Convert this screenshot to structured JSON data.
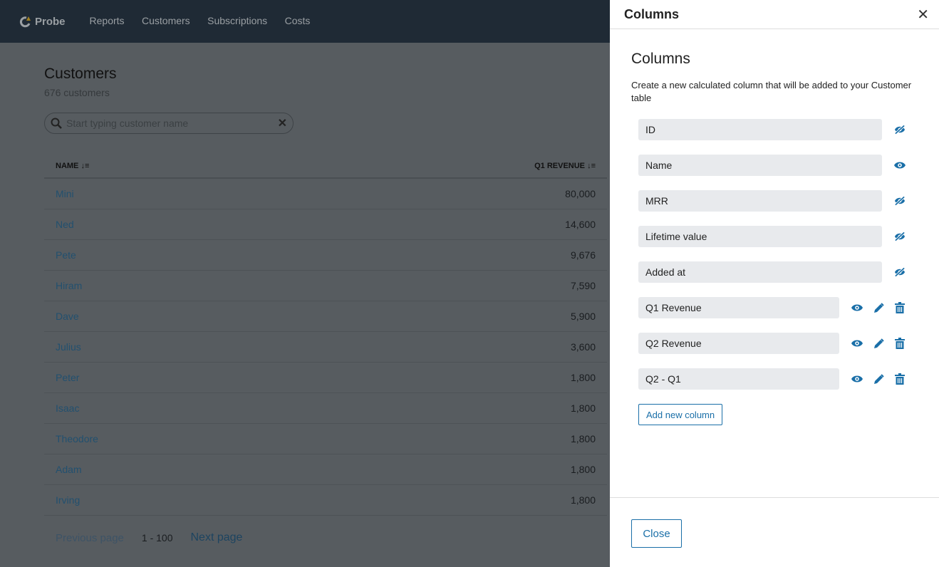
{
  "app": {
    "brand": "Probe",
    "nav": [
      "Reports",
      "Customers",
      "Subscriptions",
      "Costs"
    ]
  },
  "page": {
    "title": "Customers",
    "count": "676 customers",
    "search_placeholder": "Start typing customer name"
  },
  "table": {
    "headers": [
      "NAME",
      "Q1 REVENUE"
    ],
    "rows": [
      [
        "Mini",
        "80,000"
      ],
      [
        "Ned",
        "14,600"
      ],
      [
        "Pete",
        "9,676"
      ],
      [
        "Hiram",
        "7,590"
      ],
      [
        "Dave",
        "5,900"
      ],
      [
        "Julius",
        "3,600"
      ],
      [
        "Peter",
        "1,800"
      ],
      [
        "Isaac",
        "1,800"
      ],
      [
        "Theodore",
        "1,800"
      ],
      [
        "Adam",
        "1,800"
      ],
      [
        "Irving",
        "1,800"
      ]
    ]
  },
  "pager": {
    "prev": "Previous page",
    "range": "1 - 100",
    "next": "Next page"
  },
  "panel": {
    "title": "Columns",
    "heading": "Columns",
    "description": "Create a new calculated column that will be added to your Customer table",
    "add_label": "Add new column",
    "close_label": "Close",
    "columns": [
      {
        "name": "ID",
        "visible": false,
        "custom": false
      },
      {
        "name": "Name",
        "visible": true,
        "custom": false
      },
      {
        "name": "MRR",
        "visible": false,
        "custom": false
      },
      {
        "name": "Lifetime value",
        "visible": false,
        "custom": false
      },
      {
        "name": "Added at",
        "visible": false,
        "custom": false
      },
      {
        "name": "Q1 Revenue",
        "visible": true,
        "custom": true
      },
      {
        "name": "Q2 Revenue",
        "visible": true,
        "custom": true
      },
      {
        "name": "Q2 - Q1",
        "visible": true,
        "custom": true
      }
    ]
  },
  "colors": {
    "accent": "#1a6fa8",
    "header": "#2d3e50",
    "field": "#e8eaed"
  }
}
